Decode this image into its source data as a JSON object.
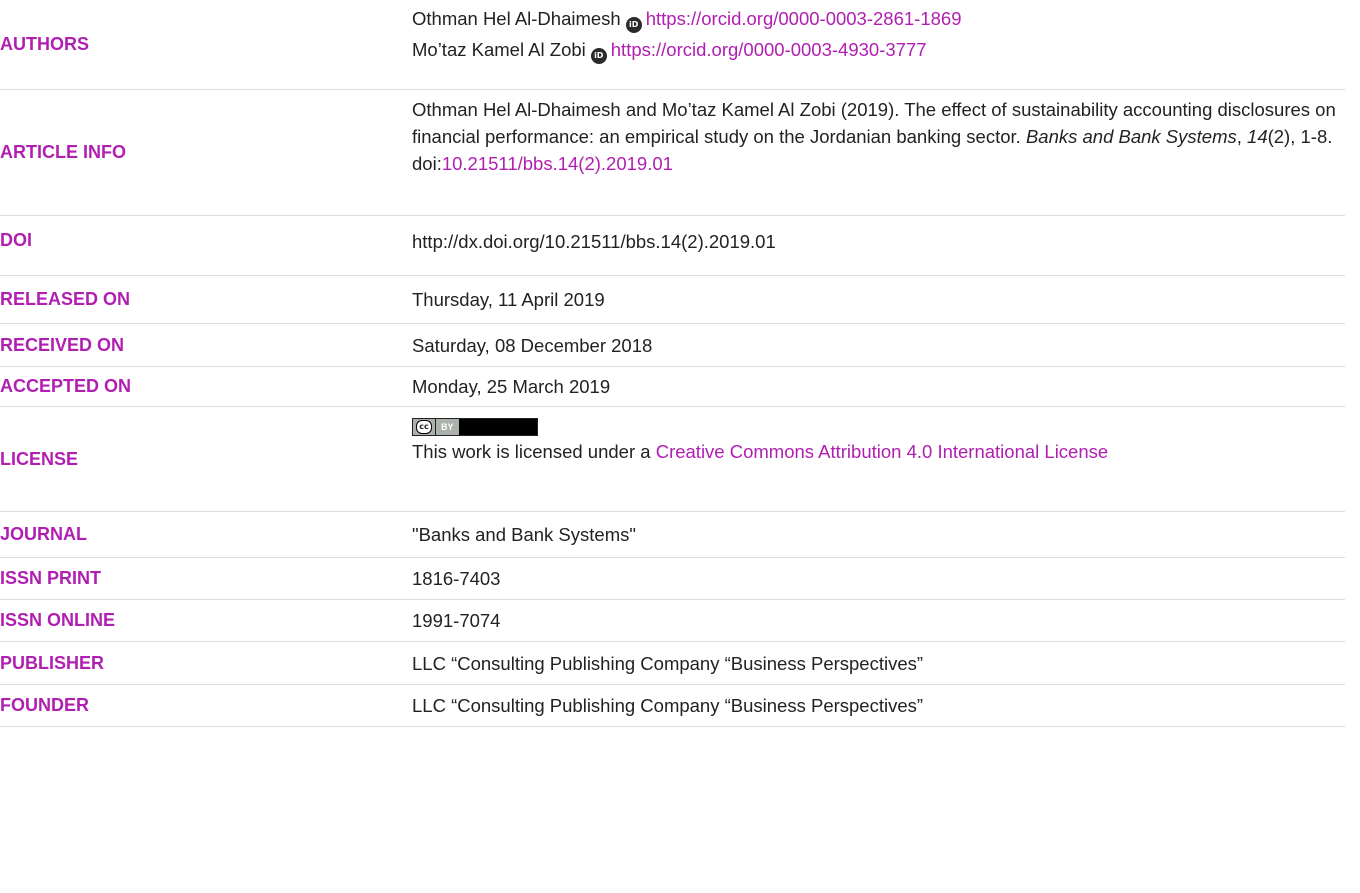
{
  "rows": {
    "authors": {
      "label": "AUTHORS",
      "author1_name": "Othman Hel Al-Dhaimesh",
      "author1_orcid": "https://orcid.org/0000-0003-2861-1869",
      "author2_name": "Mo’taz Kamel Al Zobi",
      "author2_orcid": "https://orcid.org/0000-0003-4930-3777",
      "orcid_icon": "iD"
    },
    "article_info": {
      "label": "ARTICLE INFO",
      "citation_start": "Othman Hel Al-Dhaimesh and Mo’taz Kamel Al Zobi (2019). The effect of sustainability accounting disclosures on financial performance: an empirical study on the Jordanian banking sector.",
      "journal": "Banks and Bank Systems",
      "sep1": ",",
      "volume": "14",
      "issue_pages": "(2), 1-8.",
      "doi_prefix": "doi:",
      "doi_link": "10.21511/bbs.14(2).2019.01"
    },
    "doi": {
      "label": "DOI",
      "value": "http://dx.doi.org/10.21511/bbs.14(2).2019.01"
    },
    "released": {
      "label": "RELEASED ON",
      "value": "Thursday, 11 April 2019"
    },
    "received": {
      "label": "RECEIVED ON",
      "value": "Saturday, 08 December 2018"
    },
    "accepted": {
      "label": "ACCEPTED ON",
      "value": "Monday, 25 March 2019"
    },
    "license": {
      "label": "LICENSE",
      "badge_cc": "cc",
      "badge_by": "BY",
      "text": "This work is licensed under a",
      "link": "Creative Commons Attribution 4.0 International License"
    },
    "journal": {
      "label": "JOURNAL",
      "value": "\"Banks and Bank Systems\""
    },
    "issn_print": {
      "label": "ISSN PRINT",
      "value": "1816-7403"
    },
    "issn_online": {
      "label": "ISSN ONLINE",
      "value": "1991-7074"
    },
    "publisher": {
      "label": "PUBLISHER",
      "value": "LLC “Consulting Publishing Company “Business Perspectives”"
    },
    "founder": {
      "label": "FOUNDER",
      "value": "LLC “Consulting Publishing Company “Business Perspectives”"
    }
  },
  "colors": {
    "accent": "#b01fb1",
    "text": "#222222",
    "divider": "#dcdcdc"
  }
}
